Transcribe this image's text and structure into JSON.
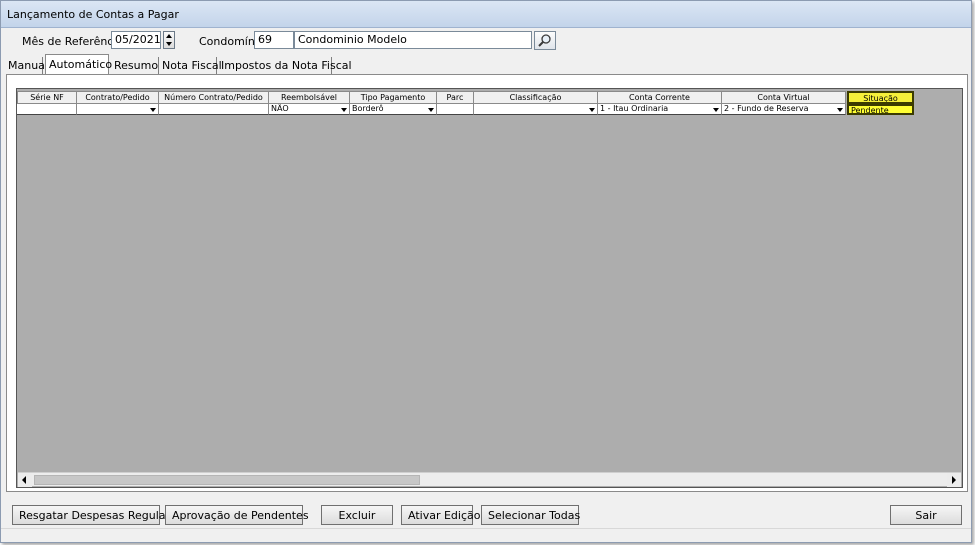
{
  "window": {
    "title": "Lançamento de Contas a Pagar"
  },
  "filters": {
    "mes_label": "Mês de Referência:",
    "mes_value": "05/2021",
    "condominio_label": "Condomínio:",
    "condominio_code": "69",
    "condominio_name": "Condominio Modelo"
  },
  "tabs": [
    {
      "label": "Manual"
    },
    {
      "label": "Automático",
      "active": true
    },
    {
      "label": "Resumo"
    },
    {
      "label": "Nota Fiscal"
    },
    {
      "label": "Impostos da Nota Fiscal"
    }
  ],
  "grid": {
    "columns": [
      "Série NF",
      "Contrato/Pedido",
      "Número Contrato/Pedido",
      "Reembolsável",
      "Tipo Pagamento",
      "Parc",
      "Classificação",
      "Conta Corrente",
      "Conta Virtual",
      "Situação"
    ],
    "row": [
      "",
      "",
      "",
      "NÃO",
      "Borderô",
      "",
      "",
      "1 - Itau Ordinaria",
      "2 - Fundo de Reserva",
      "Pendente"
    ]
  },
  "buttons": {
    "resgatar": "Resgatar Despesas Regulares",
    "aprovacao": "Aprovação de Pendentes",
    "excluir": "Excluir",
    "ativar": "Ativar Edição",
    "selecionar": "Selecionar Todas",
    "sair": "Sair"
  },
  "colors": {
    "highlight": "#ffff33",
    "grid_background": "#adadad"
  }
}
